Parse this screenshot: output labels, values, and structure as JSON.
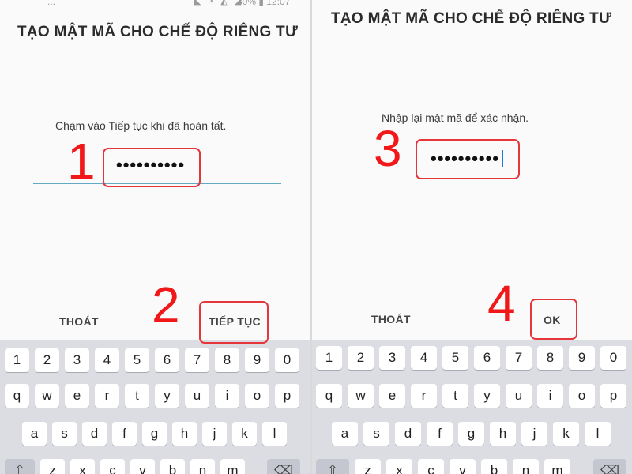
{
  "left": {
    "title": "TẠO MẬT MÃ CHO CHẾ ĐỘ RIÊNG TƯ",
    "instruction": "Chạm vào Tiếp tục khi đã hoàn tất.",
    "password_value": "••••••••••",
    "exit_button": "THOÁT",
    "continue_button": "TIẾP TỤC",
    "status": {
      "left_text": "...",
      "right_text": "30% ▮ 12:07"
    }
  },
  "right": {
    "title": "TẠO MẬT MÃ CHO CHẾ ĐỘ RIÊNG TƯ",
    "instruction": "Nhập lại mật mã để xác nhận.",
    "password_value": "••••••••••",
    "exit_button": "THOÁT",
    "ok_button": "OK"
  },
  "steps": [
    "1",
    "2",
    "3",
    "4"
  ],
  "keyboard": {
    "number_row": [
      "1",
      "2",
      "3",
      "4",
      "5",
      "6",
      "7",
      "8",
      "9",
      "0"
    ],
    "qwerty_row": [
      "q",
      "w",
      "e",
      "r",
      "t",
      "y",
      "u",
      "i",
      "o",
      "p"
    ],
    "asdf_row": [
      "a",
      "s",
      "d",
      "f",
      "g",
      "h",
      "j",
      "k",
      "l"
    ],
    "bottom_partial_row": [
      "⇧",
      "z",
      "x",
      "c",
      "v",
      "b",
      "n",
      "m",
      "⌫"
    ]
  },
  "colors": {
    "highlight": "#e5363c",
    "step_number": "#f01818",
    "underline": "#62a9c4",
    "cursor": "#1e7bd9"
  }
}
